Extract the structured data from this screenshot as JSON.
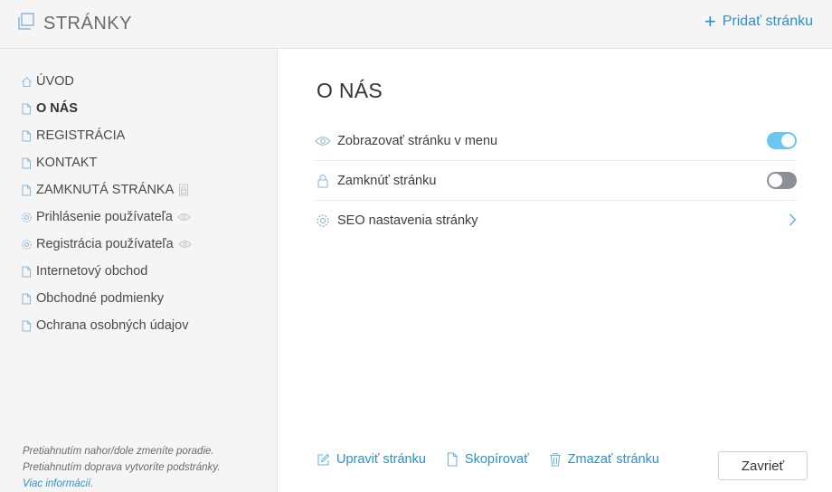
{
  "header": {
    "title": "STRÁNKY",
    "add_label": "Pridať stránku",
    "icons": {
      "title": "pages-icon",
      "add": "plus-icon"
    }
  },
  "sidebar": {
    "items": [
      {
        "label": "ÚVOD",
        "icon": "home-icon"
      },
      {
        "label": "O NÁS",
        "icon": "page-icon",
        "active": true
      },
      {
        "label": "REGISTRÁCIA",
        "icon": "page-icon"
      },
      {
        "label": "KONTAKT",
        "icon": "page-icon"
      },
      {
        "label": "ZAMKNUTÁ STRÁNKA",
        "icon": "page-icon",
        "suffix_icon": "lock-icon"
      },
      {
        "label": "Prihlásenie používateľa",
        "icon": "gear-icon",
        "suffix_icon": "eye-icon"
      },
      {
        "label": "Registrácia používateľa",
        "icon": "gear-icon",
        "suffix_icon": "eye-icon"
      },
      {
        "label": "Internetový obchod",
        "icon": "page-icon"
      },
      {
        "label": "Obchodné podmienky",
        "icon": "page-icon"
      },
      {
        "label": "Ochrana osobných údajov",
        "icon": "page-icon"
      }
    ],
    "hint_line1": "Pretiahnutím nahor/dole zmeníte poradie.",
    "hint_line2": "Pretiahnutím doprava vytvoríte podstránky.",
    "hint_link": "Viac informácií."
  },
  "main": {
    "title": "O NÁS",
    "settings": [
      {
        "label": "Zobrazovať stránku v menu",
        "icon": "eye-icon",
        "control": "toggle",
        "value": true
      },
      {
        "label": "Zamknúť stránku",
        "icon": "lock-icon",
        "control": "toggle",
        "value": false
      },
      {
        "label": "SEO nastavenia stránky",
        "icon": "gear-icon",
        "control": "chevron-right-icon"
      }
    ],
    "actions": {
      "edit": "Upraviť stránku",
      "copy": "Skopírovať",
      "delete": "Zmazať stránku"
    },
    "close_label": "Zavrieť"
  },
  "colors": {
    "accent": "#2d8fcf",
    "toggle_on": "#6cc6f0",
    "toggle_off": "#8b8f96",
    "panel_bg": "#f5f5f5"
  }
}
